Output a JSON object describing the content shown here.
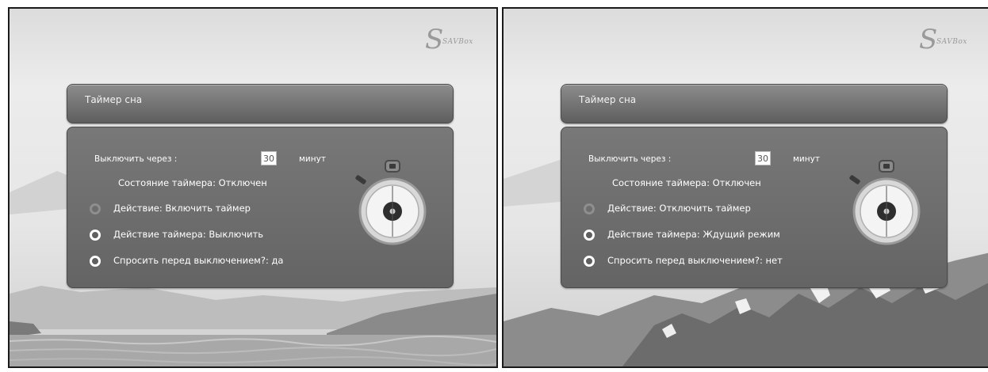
{
  "screens": [
    {
      "logo": "SAVBox",
      "title": "Таймер сна",
      "turn_off_label": "Выключить через :",
      "turn_off_value": "30",
      "unit": "минут",
      "status": "Состояние таймера:  Отключен",
      "option_action": "Действие: Включить таймер",
      "option_timer_action": "Действие таймера: Выключить",
      "option_ask": "Спросить перед выключением?:  да"
    },
    {
      "logo": "SAVBox",
      "title": "Таймер сна",
      "turn_off_label": "Выключить через :",
      "turn_off_value": "30",
      "unit": "минут",
      "status": "Состояние таймера:  Отключен",
      "option_action": "Действие: Отключить таймер",
      "option_timer_action": "Действие таймера: Ждущий режим",
      "option_ask": "Спросить перед выключением?:  нет"
    }
  ],
  "icons": [
    "stopwatch-icon",
    "radio-icon",
    "logo-icon"
  ],
  "colors": {
    "panel": "#6e6e6e",
    "title_bar": "#757575",
    "text": "#ffffff",
    "background": "#e6e6e6"
  }
}
